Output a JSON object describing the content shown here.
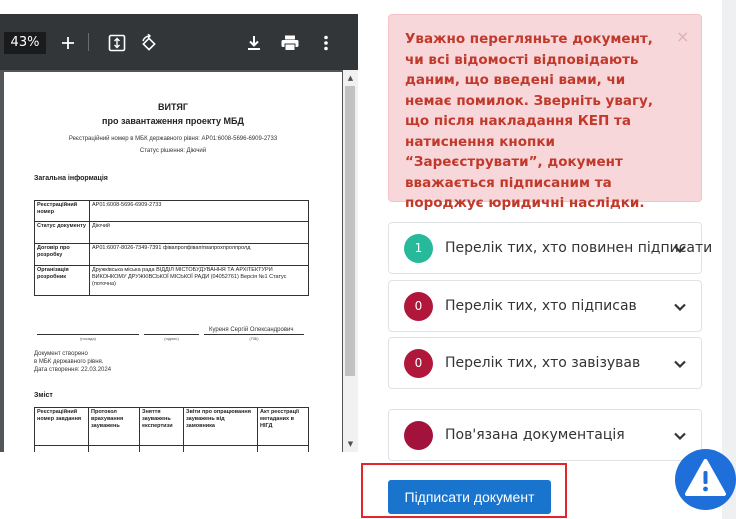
{
  "viewer": {
    "zoom": "43%",
    "icons": [
      "plus-icon",
      "fit-page-icon",
      "rotate-icon",
      "download-icon",
      "print-icon",
      "more-vert-icon"
    ]
  },
  "doc": {
    "title": "ВИТЯГ",
    "subtitle": "про завантаження проекту МБД",
    "reg_line": "Реєстраційний номер в МБК державного рівня: AP01:6008-5696-6909-2733",
    "status_line": "Статус рішення: Діючий",
    "general_heading": "Загальна інформація",
    "info_rows": [
      {
        "k": "Реєстраційний номер",
        "v": "AP01:6008-5696-6909-2733"
      },
      {
        "k": "Статус документу",
        "v": "Діючий"
      },
      {
        "k": "Договір про розробку",
        "v": "AP01:6007-8026-7349-7391 фівапролфівапітвапрохпролпролд"
      },
      {
        "k": "Організація розробник",
        "v": "Дружківська міська рада ВІДДІЛ МІСТОБУДУВАННЯ ТА АРХІТЕКТУРИ ВИКОНКОМУ ДРУЖКІВСЬКОЇ МІСЬКОЇ РАДИ (04052761) Версія №1 Статус (поточна)"
      }
    ],
    "signer_name": "Куреня Сергій Олександрович",
    "sig_captions": [
      "(посада)",
      "(підпис)",
      "(ПІБ)"
    ],
    "created_1": "Документ створено",
    "created_2": "в МБК державного рівня.",
    "created_3": "Дата створення: 22.03.2024",
    "contents_heading": "Зміст",
    "contents_cols": [
      "Реєстраційний номер завдання",
      "Протокол врахування зауважень",
      "Зняття зауважень експертизи",
      "Звіти про опрацювання зауважень від замовника",
      "Акт реєстрації метаданих в НІГД"
    ]
  },
  "alert": {
    "text": "Уважно перегляньте документ, чи всі відомості відповідають даним, що введені вами, чи немає помилок. Зверніть увагу, що після накладання КЕП та натиснення кнопки “Зареєструвати”, документ вважається підписаним та породжує юридичні наслідки.",
    "close": "×"
  },
  "accordion": [
    {
      "count": "1",
      "label": "Перелік тих, хто повинен підписати",
      "color": "#26b99a"
    },
    {
      "count": "0",
      "label": "Перелік тих, хто підписав",
      "color": "#b0173b"
    },
    {
      "count": "0",
      "label": "Перелік тих, хто завізував",
      "color": "#b0173b"
    },
    {
      "count": "",
      "label": "Пов'язана документація",
      "color": "#a3123a"
    }
  ],
  "sign_button": "Підписати документ",
  "colors": {
    "primary": "#1874cd",
    "alert_text": "#c0392b",
    "highlight": "#e3262b"
  }
}
